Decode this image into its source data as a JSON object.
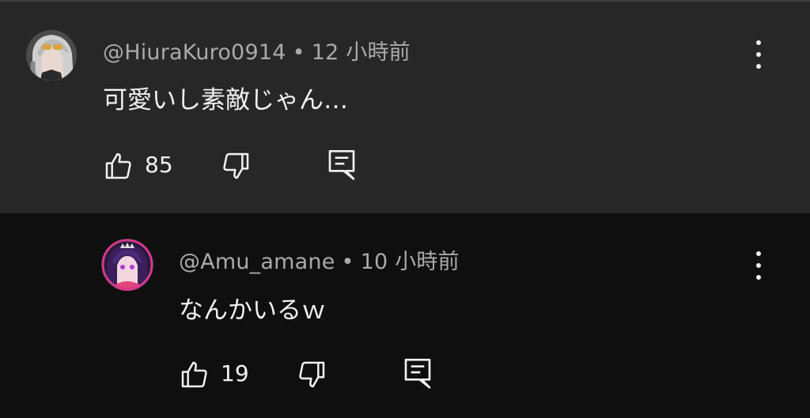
{
  "comments": [
    {
      "handle": "@HiuraKuro0914",
      "separator": "•",
      "time": "12 小時前",
      "text": "可愛いし素敵じゃん…",
      "likes": "85",
      "avatar_icon": "user-avatar-silver-hair-sunglasses",
      "icons": [
        "thumbs-up-icon",
        "thumbs-down-icon",
        "reply-comment-icon",
        "more-vert-icon"
      ]
    },
    {
      "handle": "@Amu_amane",
      "separator": "•",
      "time": "10 小時前",
      "text": "なんかいるｗ",
      "likes": "19",
      "avatar_icon": "user-avatar-purple-hair-crown",
      "icons": [
        "thumbs-up-icon",
        "thumbs-down-icon",
        "reply-comment-icon",
        "more-vert-icon"
      ]
    }
  ],
  "colors": {
    "comment_highlight_bg": "#272727",
    "page_bg": "#0f0f0f",
    "text_primary": "#f1f1f1",
    "text_secondary": "#aaaaaa"
  }
}
